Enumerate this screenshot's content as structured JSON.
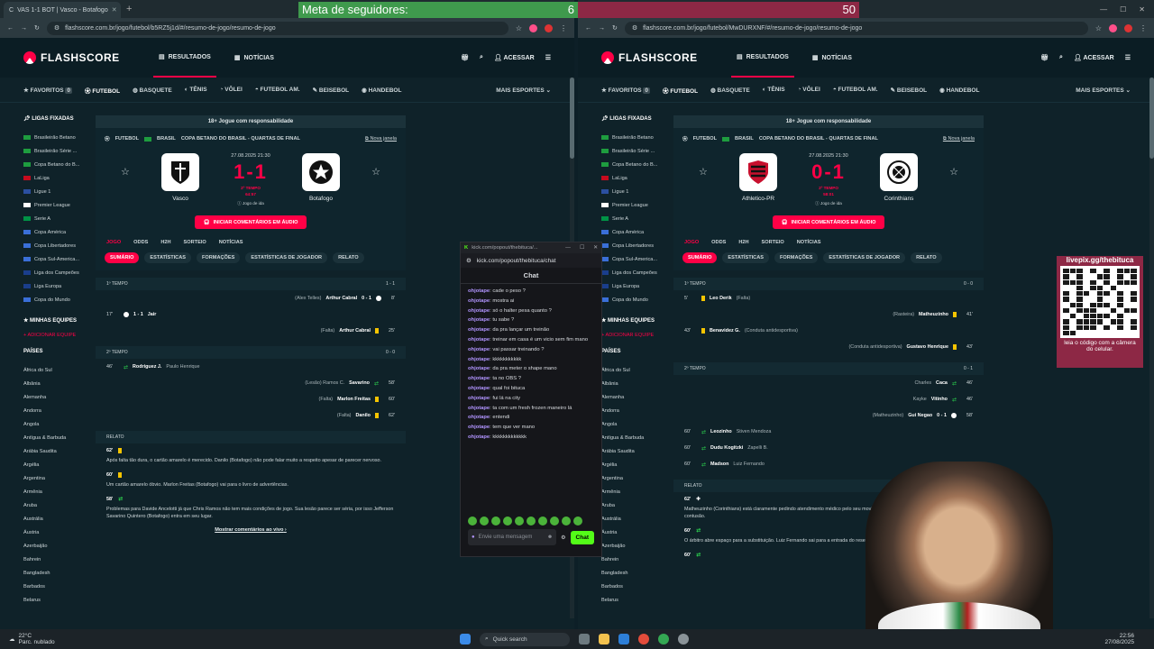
{
  "overlay": {
    "follower_label": "Meta de seguidores:",
    "follower_current": "6",
    "follower_goal": "50"
  },
  "left": {
    "tab_title": "VAS 1-1 BOT | Vasco - Botafogo",
    "url": "flashscore.com.br/jogo/futebol/b5RZ5j1d/#/resumo-de-jogo/resumo-de-jogo",
    "competition": "COPA BETANO DO BRASIL - QUARTAS DE FINAL",
    "datetime": "27.08.2025 21:30",
    "home": "Vasco",
    "away": "Botafogo",
    "score": "1-1",
    "status1": "2º TEMPO",
    "status2": "64:57",
    "leg": "Jogo de ida",
    "pinned": [
      "Brasileirão Betano",
      "Brasileirão Série ...",
      "Copa Betano do B...",
      "LaLiga",
      "Ligue 1",
      "Premier League",
      "Serie A",
      "Copa América",
      "Copa Libertadores",
      "Copa Sul-America...",
      "Liga dos Campeões",
      "Liga Europa",
      "Copa do Mundo"
    ],
    "countries": [
      "África do Sul",
      "Albânia",
      "Alemanha",
      "Andorra",
      "Angola",
      "Antígua & Barbuda",
      "Arábia Saudita",
      "Argélia",
      "Argentina",
      "Armênia",
      "Aruba",
      "Austrália",
      "Áustria",
      "Azerbaijão",
      "Bahrein",
      "Bangladesh",
      "Barbados",
      "Belarus"
    ],
    "events": [
      {
        "type": "section",
        "label": "1º TEMPO",
        "score": "1 - 1"
      },
      {
        "type": "right",
        "min": "8'",
        "player": "Arthur Cabral",
        "note": "(Alex Telles)",
        "score": "0 - 1",
        "icon": "ball"
      },
      {
        "type": "left",
        "min": "17'",
        "player": "Jair",
        "score": "1 - 1",
        "icon": "ball"
      },
      {
        "type": "right",
        "min": "25'",
        "player": "Arthur Cabral",
        "note": "(Falta)",
        "icon": "yc"
      },
      {
        "type": "section",
        "label": "2º TEMPO",
        "score": "0 - 0"
      },
      {
        "type": "left",
        "min": "46'",
        "player": "Rodriguez J.",
        "note": "Paulo Henrique",
        "icon": "sub"
      },
      {
        "type": "right",
        "min": "58'",
        "player": "Savarino",
        "note": "(Lesão) Ramos C.",
        "icon": "sub"
      },
      {
        "type": "right",
        "min": "60'",
        "player": "Marlon Freitas",
        "note": "(Falta)",
        "icon": "yc"
      },
      {
        "type": "right",
        "min": "62'",
        "player": "Danilo",
        "note": "(Falta)",
        "icon": "yc"
      }
    ],
    "report": [
      {
        "min": "62'",
        "icon": "yc",
        "text": "Após falta tão dura, o cartão amarelo é merecido. Danilo (Botafogo) não pode falar muito a respeito apesar de parecer nervoso."
      },
      {
        "min": "60'",
        "icon": "yc",
        "text": "Um cartão amarelo óbvio. Marlon Freitas (Botafogo) vai para o livro de advertências."
      },
      {
        "min": "58'",
        "icon": "sub",
        "text": "Problemas para Davide Ancelotti já que Chris Ramos não tem mais condições de jogo. Sua lesão parece ser séria, por isso Jefferson Savarino Quintero (Botafogo) entra em seu lugar."
      }
    ],
    "more_comments": "Mostrar comentários ao vivo"
  },
  "right": {
    "url": "flashscore.com.br/jogo/futebol/MwDURXNF/#/resumo-de-jogo/resumo-de-jogo",
    "competition": "COPA BETANO DO BRASIL - QUARTAS DE FINAL",
    "datetime": "27.08.2025 21:30",
    "home": "Athletico-PR",
    "away": "Corinthians",
    "score": "0-1",
    "status1": "2º TEMPO",
    "status2": "58:01",
    "leg": "Jogo de ida",
    "pinned": [
      "Brasileirão Betano",
      "Brasileirão Série ...",
      "Copa Betano do B...",
      "LaLiga",
      "Ligue 1",
      "Premier League",
      "Serie A",
      "Copa América",
      "Copa Libertadores",
      "Copa Sul-America...",
      "Liga dos Campeões",
      "Liga Europa",
      "Copa do Mundo"
    ],
    "countries": [
      "África do Sul",
      "Albânia",
      "Alemanha",
      "Andorra",
      "Angola",
      "Antígua & Barbuda",
      "Arábia Saudita",
      "Argélia",
      "Argentina",
      "Armênia",
      "Aruba",
      "Austrália",
      "Áustria",
      "Azerbaijão",
      "Bahrein",
      "Bangladesh",
      "Barbados",
      "Belarus"
    ],
    "events": [
      {
        "type": "section",
        "label": "1º TEMPO",
        "score": "0 - 0"
      },
      {
        "type": "left",
        "min": "5'",
        "player": "Leo Derik",
        "note": "(Falta)",
        "icon": "yc"
      },
      {
        "type": "right",
        "min": "41'",
        "player": "Matheuzinho",
        "note": "(Rasteira)",
        "icon": "yc"
      },
      {
        "type": "left",
        "min": "43'",
        "player": "Benavidez G.",
        "note": "(Conduta antidesportiva)",
        "icon": "yc"
      },
      {
        "type": "right",
        "min": "43'",
        "player": "Gustavo Henrique",
        "note": "(Conduta antidesportiva)",
        "icon": "yc"
      },
      {
        "type": "section",
        "label": "2º TEMPO",
        "score": "0 - 1"
      },
      {
        "type": "right",
        "min": "46'",
        "player": "Caca",
        "note": "Charles",
        "icon": "sub"
      },
      {
        "type": "right",
        "min": "46'",
        "player": "Vitinho",
        "note": "Kayke",
        "icon": "sub"
      },
      {
        "type": "right",
        "min": "58'",
        "player": "Gui Negao",
        "note": "(Matheuzinho)",
        "score": "0 - 1",
        "icon": "ball"
      },
      {
        "type": "left",
        "min": "60'",
        "player": "Leozinho",
        "note": "Stiven Mendoza",
        "icon": "sub"
      },
      {
        "type": "left",
        "min": "60'",
        "player": "Dudu Kogitzki",
        "note": "Zapelli B.",
        "icon": "sub"
      },
      {
        "type": "left",
        "min": "60'",
        "player": "Madson",
        "note": "Luiz Fernando",
        "icon": "sub"
      }
    ],
    "report": [
      {
        "min": "62'",
        "icon": "med",
        "text": "Matheuzinho (Corinthians) está claramente pedindo atendimento médico pelo seu movimento de ... descobrir quão séria é a contusão."
      },
      {
        "min": "60'",
        "icon": "sub",
        "text": "O árbitro abre espaço para a substituição. Luiz Fernando sai para a entrada do reserva Madson (Athle..."
      },
      {
        "min": "60'",
        "icon": "sub",
        "text": ""
      }
    ],
    "more_comments": ""
  },
  "common": {
    "logo": "FLASHSCORE",
    "nav_results": "RESULTADOS",
    "nav_news": "NOTÍCIAS",
    "login": "ACESSAR",
    "sports": [
      "FAVORITOS",
      "FUTEBOL",
      "BASQUETE",
      "TÊNIS",
      "VÔLEI",
      "FUTEBOL AM.",
      "BEISEBOL",
      "HANDEBOL"
    ],
    "favorites_count": "0",
    "more_sports": "MAIS ESPORTES",
    "pinned_title": "LIGAS FIXADAS",
    "teams_title": "MINHAS EQUIPES",
    "add_team": "ADICIONAR EQUIPE",
    "countries_title": "PAÍSES",
    "responsible": "18+ Jogue com responsabilidade",
    "crumb_sport": "FUTEBOL",
    "crumb_country": "BRASIL",
    "new_window": "Nova janela",
    "audio_btn": "INICIAR COMENTÁRIOS EM ÁUDIO",
    "tabs": [
      "JOGO",
      "ODDS",
      "H2H",
      "SORTEIO",
      "NOTÍCIAS"
    ],
    "subtabs": [
      "SUMÁRIO",
      "ESTATÍSTICAS",
      "FORMAÇÕES",
      "ESTATÍSTICAS DE JOGADOR",
      "RELATO"
    ],
    "report_title": "RELATO"
  },
  "chat": {
    "window_title": "kick.com/popout/thebituca/...",
    "url": "kick.com/popout/thebituca/chat",
    "title": "Chat",
    "messages": [
      {
        "user": "ohjotape",
        "text": "cade o peso ?"
      },
      {
        "user": "ohjotape",
        "text": "mostra ai"
      },
      {
        "user": "ohjotape",
        "text": "só o halter pesa quanto ?"
      },
      {
        "user": "ohjotape",
        "text": "tu sabe ?"
      },
      {
        "user": "ohjotape",
        "text": "da pra lançar um treinão"
      },
      {
        "user": "ohjotape",
        "text": "treinar em casa é um vicio sem fim mano"
      },
      {
        "user": "ohjotape",
        "text": "vai passar treinando ?"
      },
      {
        "user": "ohjotape",
        "text": "kkkkkkkkkkk"
      },
      {
        "user": "ohjotape",
        "text": "da pra meter o shape mano"
      },
      {
        "user": "ohjotape",
        "text": "ta no OBS ?"
      },
      {
        "user": "ohjotape",
        "text": "qual foi bituca"
      },
      {
        "user": "ohjotape",
        "text": "fui lá na city"
      },
      {
        "user": "ohjotape",
        "text": "ta com um fresh frozen maneiro lá"
      },
      {
        "user": "ohjotape",
        "text": "entendi"
      },
      {
        "user": "ohjotape",
        "text": "tem que ver mano"
      },
      {
        "user": "ohjotape",
        "text": "kkkkkkkkkkkkk"
      }
    ],
    "placeholder": "Envie uma mensagem",
    "send": "Chat"
  },
  "qr": {
    "title": "livepix.gg/thebituca",
    "caption": "leia o código com a câmera do celular."
  },
  "taskbar": {
    "temp": "22°C",
    "weather": "Parc. nublado",
    "search": "Quick search",
    "time": "22:56",
    "date": "27/08/2025"
  }
}
